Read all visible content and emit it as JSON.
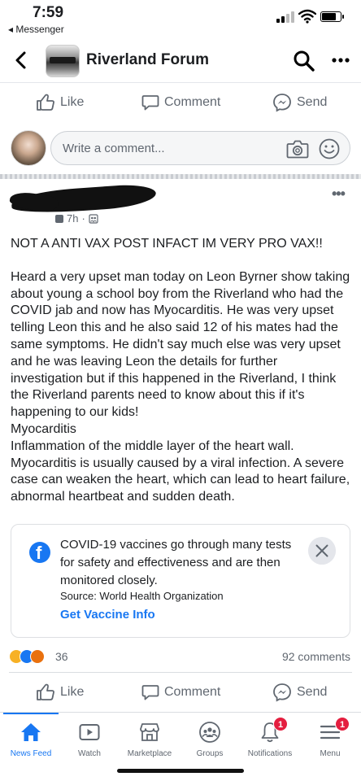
{
  "status_bar": {
    "time": "7:59",
    "back_app": "◂ Messenger",
    "battery_level": 0.8
  },
  "header": {
    "title": "Riverland Forum",
    "back_icon": "chevron-left-icon",
    "search_icon": "search-icon",
    "more_icon": "more-dots-icon"
  },
  "prev_actions": {
    "like": "Like",
    "comment": "Comment",
    "send": "Send"
  },
  "comment_box": {
    "placeholder": "Write a comment..."
  },
  "post": {
    "time": "7h",
    "headline": "NOT A ANTI VAX POST INFACT IM VERY PRO VAX!!",
    "body": "Heard a very upset man today on Leon Byrner show taking about young a school boy from the Riverland who had the COVID jab and now has Myocarditis. He was very upset telling Leon this and he also said 12 of his mates had the same symptoms. He didn't say much else was very upset and he was leaving Leon the details for further investigation but if this happened in the Riverland, I think the Riverland parents need to know about this if it's happening to our kids!\nMyocarditis\nInflammation of the middle layer of the heart wall. Myocarditis is usually caused by a viral infection. A severe case can weaken the heart, which can lead to heart failure, abnormal heartbeat and sudden death."
  },
  "info_card": {
    "text": "COVID-19 vaccines go through many tests for safety and effectiveness and are then monitored closely.",
    "source": "Source: World Health Organization",
    "link": "Get Vaccine Info"
  },
  "reactions": {
    "count": "36",
    "comments": "92 comments"
  },
  "post_actions": {
    "like": "Like",
    "comment": "Comment",
    "send": "Send"
  },
  "tabs": [
    {
      "label": "News Feed",
      "icon": "home-icon",
      "active": true
    },
    {
      "label": "Watch",
      "icon": "watch-icon"
    },
    {
      "label": "Marketplace",
      "icon": "marketplace-icon"
    },
    {
      "label": "Groups",
      "icon": "groups-icon"
    },
    {
      "label": "Notifications",
      "icon": "bell-icon",
      "badge": "1"
    },
    {
      "label": "Menu",
      "icon": "menu-icon",
      "badge": "1"
    }
  ],
  "colors": {
    "accent": "#1877f2",
    "badge": "#e41e3f",
    "secondary_text": "#606770"
  }
}
